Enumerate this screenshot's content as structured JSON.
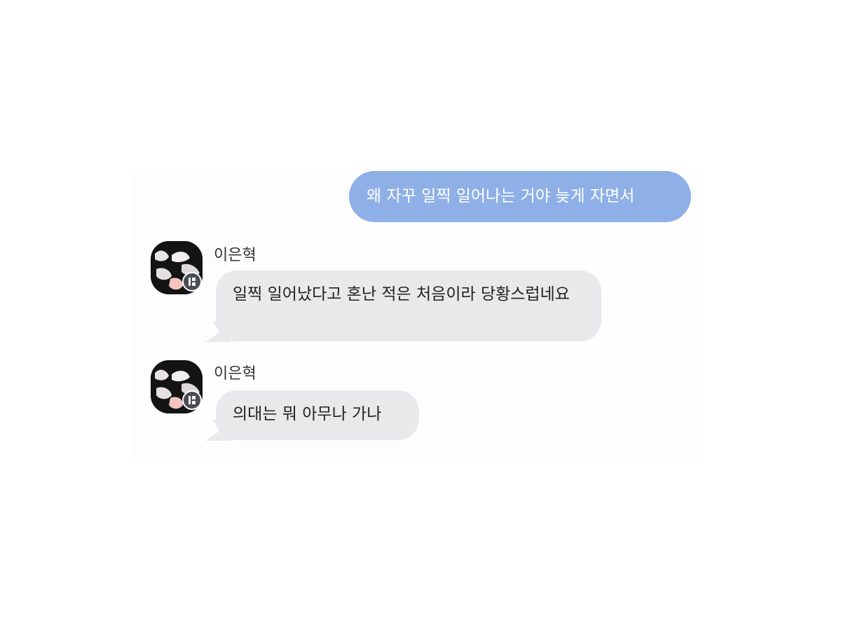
{
  "chat": {
    "messages": [
      {
        "direction": "outgoing",
        "text": "왜 자꾸 일찍 일어나는 거야 늦게 자면서"
      },
      {
        "direction": "incoming",
        "sender": "이은혁",
        "text": "일찍 일어났다고 혼난 적은 처음이라 당황스럽네요"
      },
      {
        "direction": "incoming",
        "sender": "이은혁",
        "text": "의대는 뭐 아무나 가나"
      }
    ]
  },
  "icons": {
    "avatar": "profile-photo",
    "badge": "app-badge-icon"
  },
  "colors": {
    "outgoing_bubble": "#8eb0e7",
    "incoming_bubble": "#e9e9ec",
    "badge": "#4a4d55"
  }
}
